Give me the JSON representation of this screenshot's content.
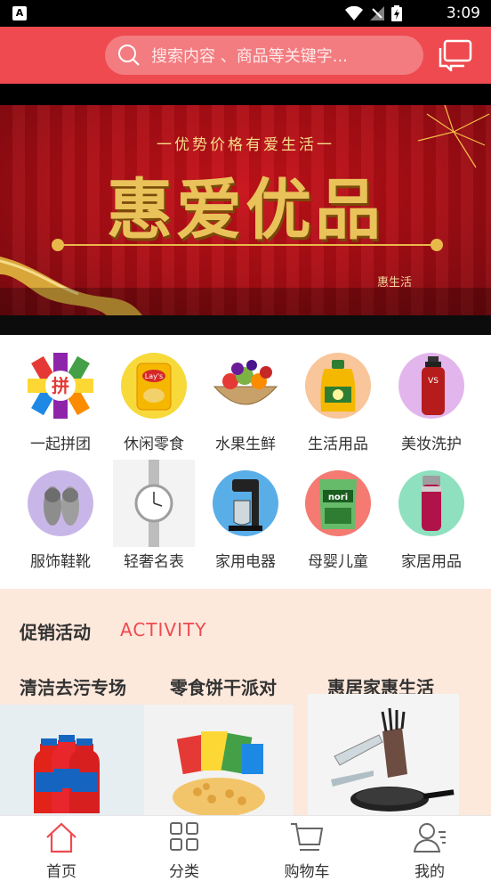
{
  "status_bar": {
    "app_badge": "A",
    "time": "3:09"
  },
  "header": {
    "search_placeholder": "搜索内容 、商品等关键字..."
  },
  "banner": {
    "subtitle": "一优势价格有爱生活一",
    "title": "惠爱优品",
    "caption": "惠生活"
  },
  "categories": [
    {
      "label": "一起拼团",
      "icon": "group-buy-icon"
    },
    {
      "label": "休闲零食",
      "icon": "snack-chips-icon"
    },
    {
      "label": "水果生鲜",
      "icon": "fruit-basket-icon"
    },
    {
      "label": "生活用品",
      "icon": "cooking-oil-icon"
    },
    {
      "label": "美妆洗护",
      "icon": "shampoo-bottle-icon"
    },
    {
      "label": "服饰鞋靴",
      "icon": "slippers-icon"
    },
    {
      "label": "轻奢名表",
      "icon": "wristwatch-icon"
    },
    {
      "label": "家用电器",
      "icon": "coffee-maker-icon"
    },
    {
      "label": "母婴儿童",
      "icon": "seaweed-snack-icon"
    },
    {
      "label": "家居用品",
      "icon": "thermos-icon"
    }
  ],
  "promotions": {
    "heading": "促销活动",
    "heading_en": "ACTIVITY",
    "cards": [
      {
        "title": "清洁去污专场",
        "image": "detergent-bottles"
      },
      {
        "title": "零食饼干派对",
        "image": "snack-assortment"
      },
      {
        "title": "惠居家惠生活",
        "image": "knife-and-pan-set"
      }
    ]
  },
  "tabbar": [
    {
      "label": "首页",
      "icon": "home-icon",
      "active": true
    },
    {
      "label": "分类",
      "icon": "category-grid-icon",
      "active": false
    },
    {
      "label": "购物车",
      "icon": "cart-icon",
      "active": false
    },
    {
      "label": "我的",
      "icon": "user-icon",
      "active": false
    }
  ],
  "colors": {
    "brand": "#ee4a4f",
    "promo_bg": "#fde8dc"
  }
}
